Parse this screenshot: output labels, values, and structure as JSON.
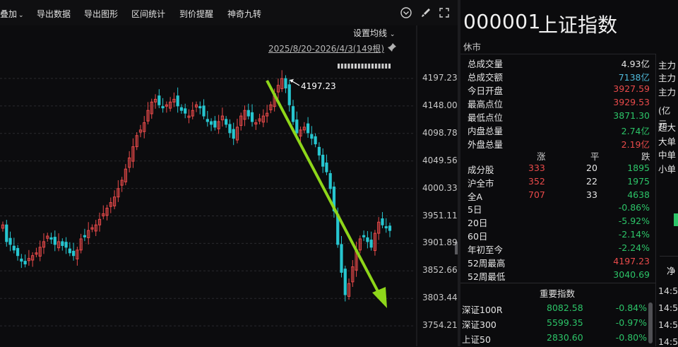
{
  "toolbar": {
    "items": [
      "叠加",
      "导出数据",
      "导出图形",
      "区间统计",
      "到价提醒",
      "神奇九转"
    ]
  },
  "chart": {
    "ma_setting": "设置均线",
    "range_label": "2025/8/20-2026/4/3(149根)",
    "peak_label": "4197.23",
    "price_levels": [
      "4197.23",
      "4148.00",
      "4098.78",
      "4049.56",
      "4000.33",
      "3951.11",
      "3901.89",
      "3852.66",
      "3803.44",
      "3754.21"
    ]
  },
  "header": {
    "code": "000001",
    "name": "上证指数",
    "status": "休市"
  },
  "stats": [
    {
      "label": "总成交量",
      "value": "4.93亿",
      "color": "white"
    },
    {
      "label": "总成交额",
      "value": "7138亿",
      "color": "cyan"
    },
    {
      "label": "今日开盘",
      "value": "3927.59",
      "color": "red"
    },
    {
      "label": "最高点位",
      "value": "3929.53",
      "color": "red"
    },
    {
      "label": "最低点位",
      "value": "3871.30",
      "color": "green"
    },
    {
      "label": "内盘总量",
      "value": "2.74亿",
      "color": "green"
    },
    {
      "label": "外盘总量",
      "value": "2.19亿",
      "color": "red"
    }
  ],
  "breadth": {
    "headers": [
      "涨",
      "平",
      "跌"
    ],
    "rows": [
      {
        "label": "成分股",
        "up": "333",
        "flat": "20",
        "down": "1895"
      },
      {
        "label": "沪全市",
        "up": "352",
        "flat": "22",
        "down": "1975"
      },
      {
        "label": "全A",
        "up": "707",
        "flat": "33",
        "down": "4638"
      }
    ]
  },
  "periods": [
    {
      "label": "5日",
      "value": "-0.86%",
      "color": "green"
    },
    {
      "label": "20日",
      "value": "-5.92%",
      "color": "green"
    },
    {
      "label": "60日",
      "value": "-2.14%",
      "color": "green"
    },
    {
      "label": "年初至今",
      "value": "-2.24%",
      "color": "green"
    },
    {
      "label": "52周最高",
      "value": "4197.23",
      "color": "red"
    },
    {
      "label": "52周最低",
      "value": "3040.69",
      "color": "green"
    }
  ],
  "indices": {
    "title": "重要指数",
    "rows": [
      {
        "name": "深证100R",
        "value": "8082.58",
        "change": "-0.84%"
      },
      {
        "name": "深证300",
        "value": "5599.35",
        "change": "-0.97%"
      },
      {
        "name": "上证50",
        "value": "2830.60",
        "change": "-0.80%"
      }
    ]
  },
  "side": {
    "labels": [
      "主力",
      "主力",
      "主力",
      "(亿元",
      "超大",
      "大单",
      "中单",
      "小单"
    ],
    "net": "净",
    "times": [
      "14:5",
      "14:5",
      "14:5",
      "14:5"
    ]
  }
}
